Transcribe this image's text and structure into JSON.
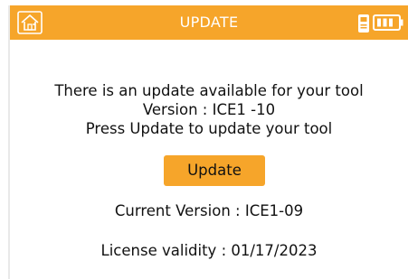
{
  "header": {
    "title": "UPDATE",
    "home_icon": "home-icon",
    "tool_icon": "tool-icon",
    "battery_icon": "battery-icon",
    "accent_color": "#f6a52a"
  },
  "message": {
    "line1": "There is an update available for your tool",
    "line2": "Version : ICE1 -10",
    "line3": "Press Update to update your tool"
  },
  "actions": {
    "update_label": "Update"
  },
  "info": {
    "current_version": "Current Version : ICE1-09",
    "license_validity": "License validity : 01/17/2023"
  }
}
